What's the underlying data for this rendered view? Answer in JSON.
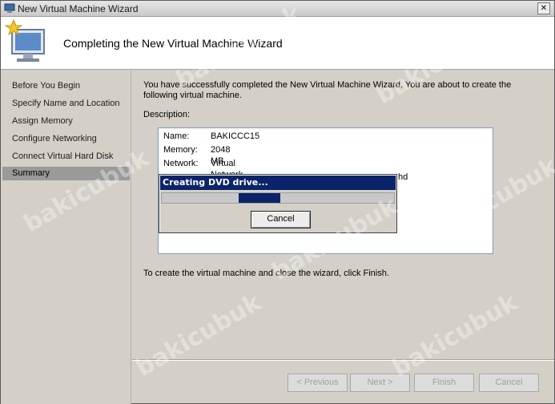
{
  "window": {
    "title": "New Virtual Machine Wizard",
    "close_label": "✕"
  },
  "header": {
    "title": "Completing the New Virtual Machine Wizard"
  },
  "sidebar": {
    "items": [
      {
        "label": "Before You Begin"
      },
      {
        "label": "Specify Name and Location"
      },
      {
        "label": "Assign Memory"
      },
      {
        "label": "Configure Networking"
      },
      {
        "label": "Connect Virtual Hard Disk"
      },
      {
        "label": "Summary",
        "active": true
      }
    ]
  },
  "main": {
    "intro": "You have successfully completed the New Virtual Machine Wizard. You are about to create the following virtual machine.",
    "description_label": "Description:",
    "description": [
      {
        "key": "Name:",
        "value": "BAKICCC15"
      },
      {
        "key": "Memory:",
        "value": "2048 MB"
      },
      {
        "key": "Network:",
        "value": "Virtual Network-1"
      }
    ],
    "description_overflow": "hd",
    "closing": "To create the virtual machine and close the wizard, click Finish."
  },
  "progress": {
    "title": "Creating DVD drive...",
    "fraction": 0.18,
    "cancel_label": "Cancel"
  },
  "footer": {
    "previous_label": "< Previous",
    "next_label": "Next >",
    "finish_label": "Finish",
    "cancel_label": "Cancel"
  },
  "watermark": "bakicubuk",
  "colors": {
    "dialog_title_bg": "#0a246a",
    "progress_fill": "#0a246a",
    "sidebar_active": "#9a9a9a"
  }
}
